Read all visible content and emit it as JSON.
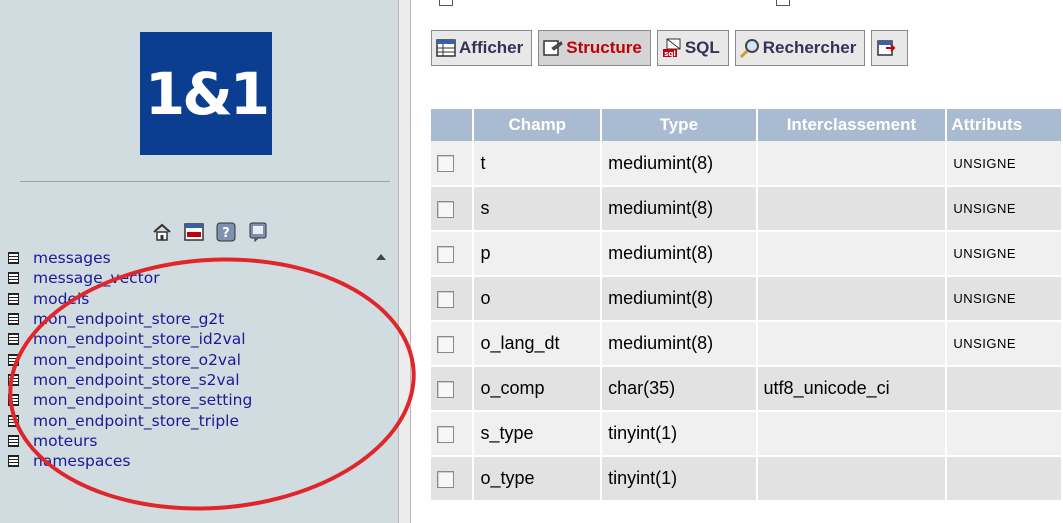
{
  "left": {
    "logo_text": "1&1",
    "nav_icons": [
      "home-icon",
      "sql-query-icon",
      "help-icon",
      "sql-docs-icon"
    ],
    "tables": [
      "messages",
      "message_vector",
      "models",
      "mon_endpoint_store_g2t",
      "mon_endpoint_store_id2val",
      "mon_endpoint_store_o2val",
      "mon_endpoint_store_s2val",
      "mon_endpoint_store_setting",
      "mon_endpoint_store_triple",
      "moteurs",
      "namespaces"
    ],
    "link_color": "#1a1a99",
    "annotation_color": "#e0262b"
  },
  "tabs": [
    {
      "label": "Afficher",
      "icon": "browse-icon",
      "active": false
    },
    {
      "label": "Structure",
      "icon": "structure-icon",
      "active": true
    },
    {
      "label": "SQL",
      "icon": "sql-icon",
      "active": false
    },
    {
      "label": "Rechercher",
      "icon": "search-icon",
      "active": false
    },
    {
      "label": "",
      "icon": "insert-icon",
      "active": false
    }
  ],
  "structure": {
    "columns": [
      "Champ",
      "Type",
      "Interclassement",
      "Attributs"
    ],
    "rows": [
      {
        "champ": "t",
        "type": "mediumint(8)",
        "interclassement": "",
        "attributs": "UNSIGNE"
      },
      {
        "champ": "s",
        "type": "mediumint(8)",
        "interclassement": "",
        "attributs": "UNSIGNE"
      },
      {
        "champ": "p",
        "type": "mediumint(8)",
        "interclassement": "",
        "attributs": "UNSIGNE"
      },
      {
        "champ": "o",
        "type": "mediumint(8)",
        "interclassement": "",
        "attributs": "UNSIGNE"
      },
      {
        "champ": "o_lang_dt",
        "type": "mediumint(8)",
        "interclassement": "",
        "attributs": "UNSIGNE"
      },
      {
        "champ": "o_comp",
        "type": "char(35)",
        "interclassement": "utf8_unicode_ci",
        "attributs": ""
      },
      {
        "champ": "s_type",
        "type": "tinyint(1)",
        "interclassement": "",
        "attributs": ""
      },
      {
        "champ": "o_type",
        "type": "tinyint(1)",
        "interclassement": "",
        "attributs": ""
      }
    ],
    "header_color": "#a8bbd0",
    "active_tab_color": "#c0000c"
  }
}
